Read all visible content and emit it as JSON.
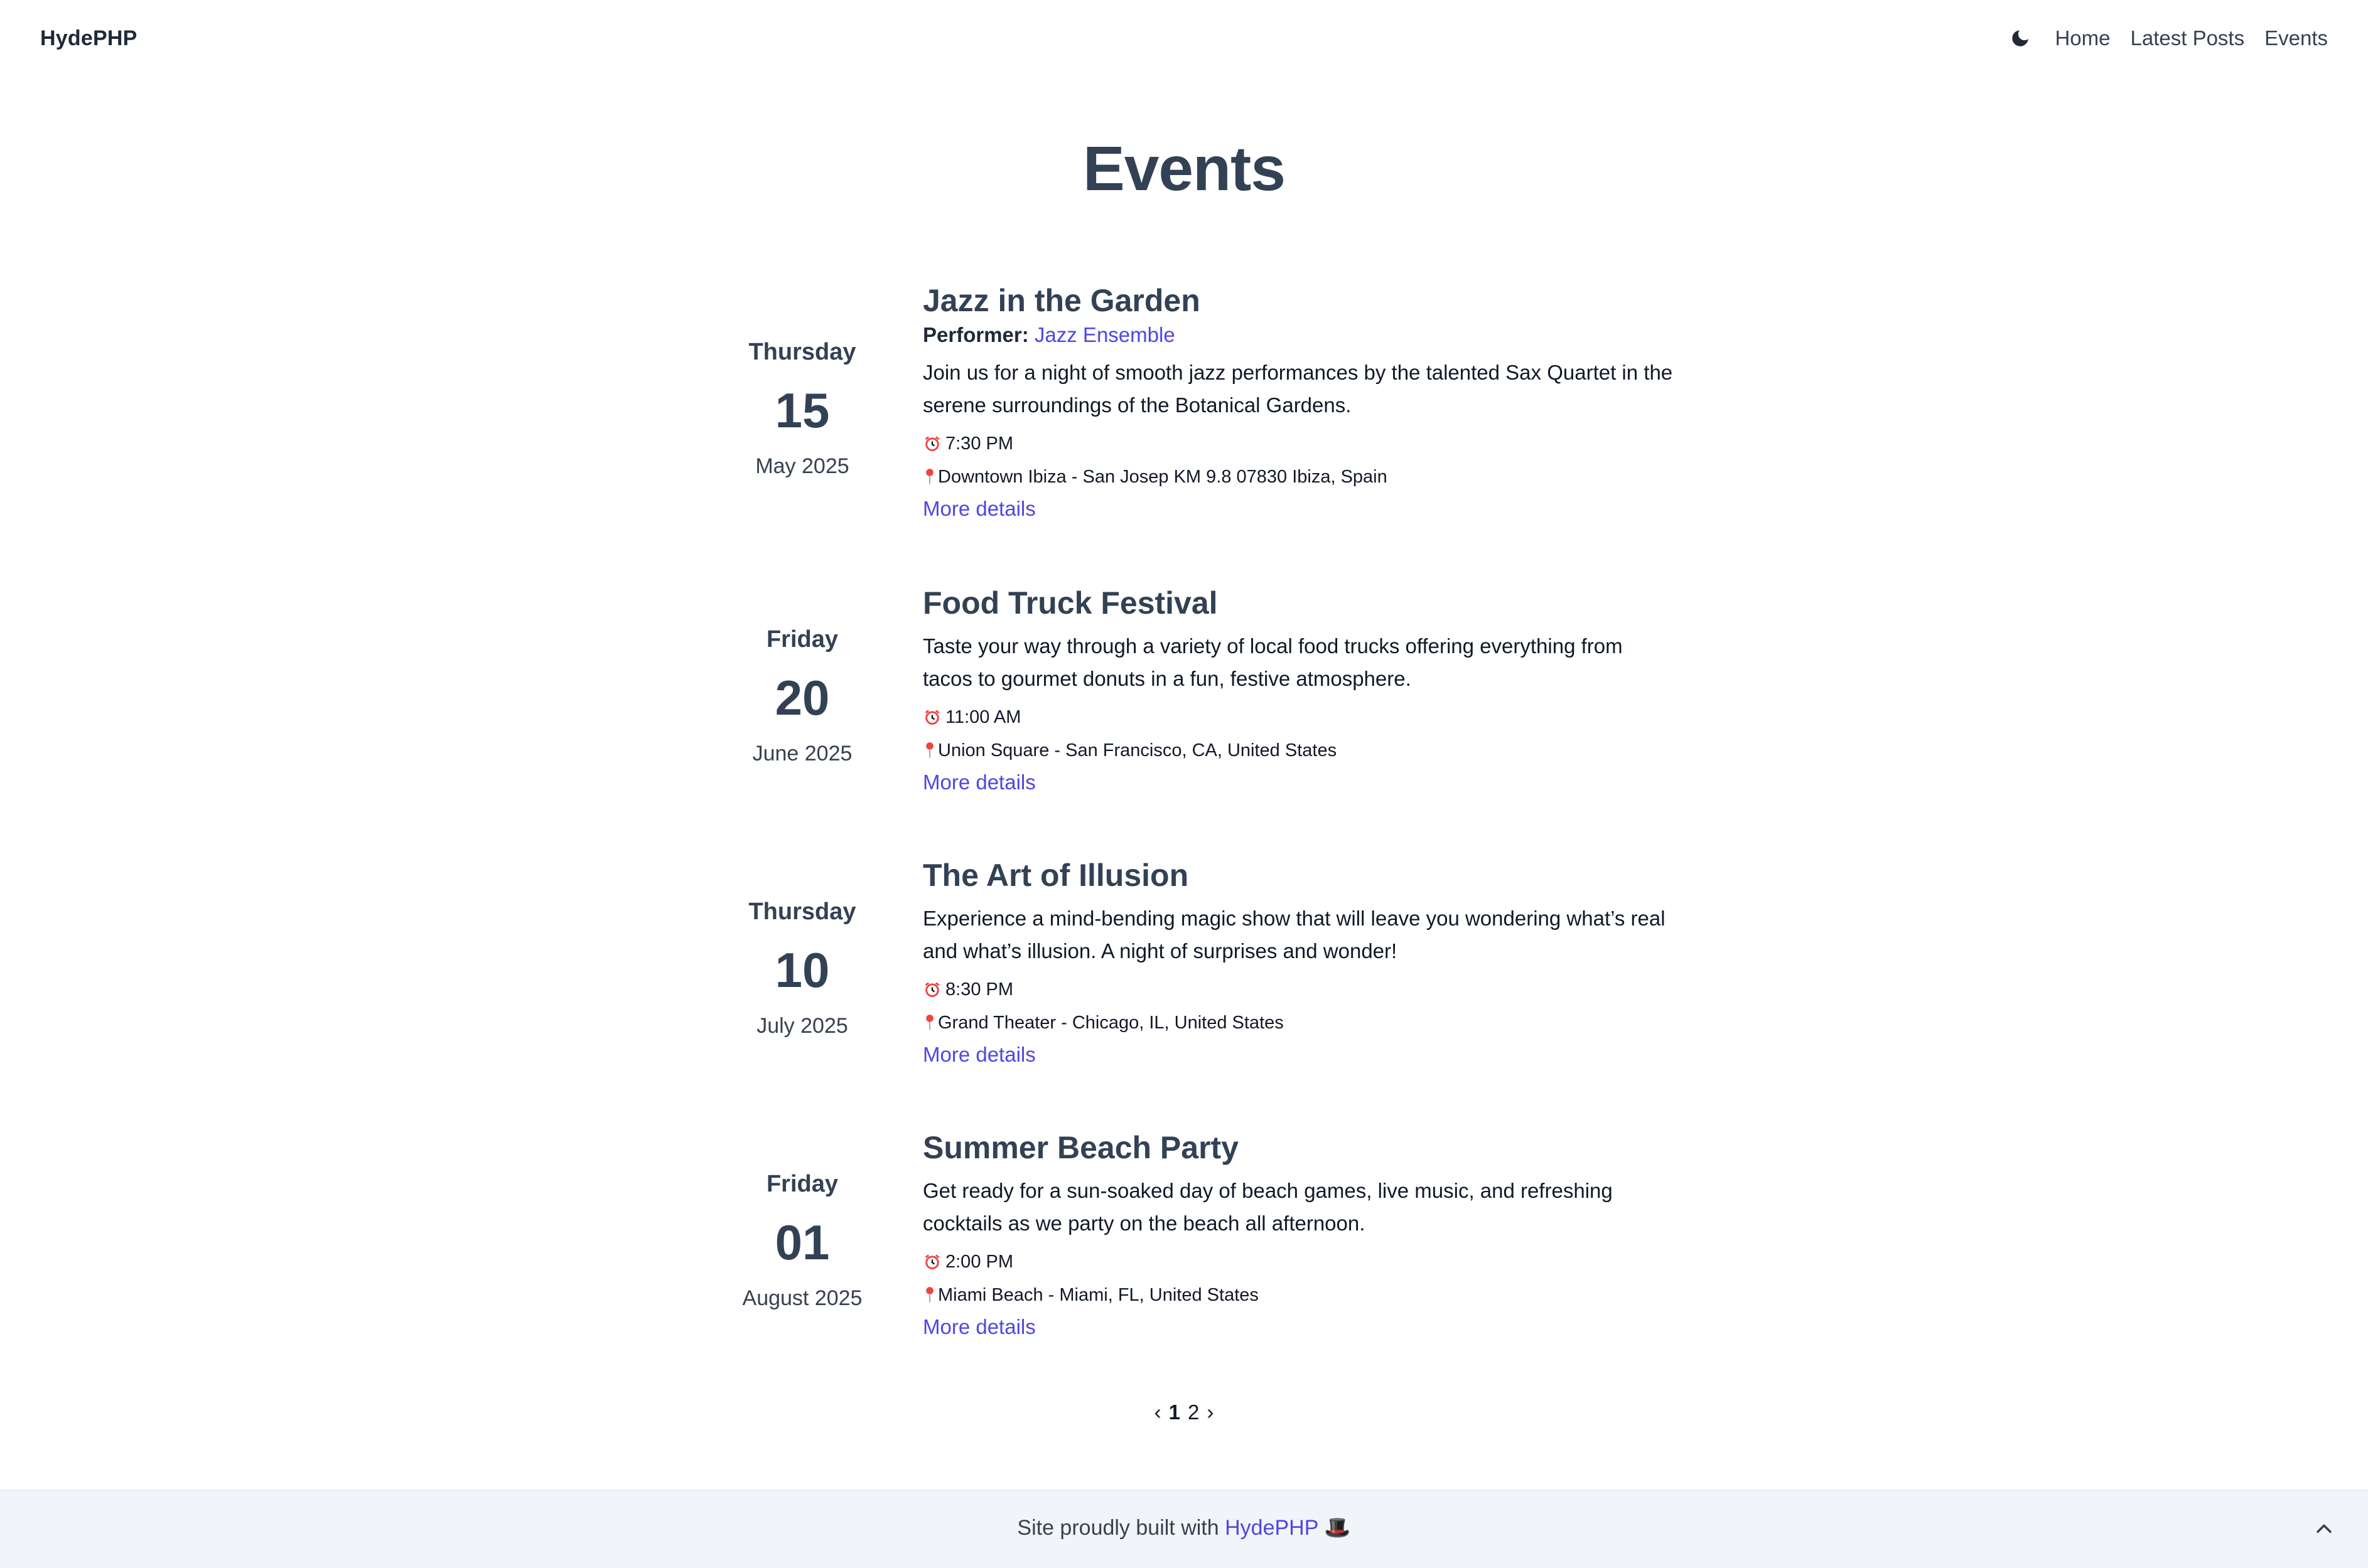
{
  "header": {
    "brand": "HydePHP",
    "nav": [
      "Home",
      "Latest Posts",
      "Events"
    ]
  },
  "page": {
    "title": "Events"
  },
  "events": [
    {
      "weekday": "Thursday",
      "day": "15",
      "month_year": "May 2025",
      "title": "Jazz in the Garden",
      "performer_label": "Performer:",
      "performer": "Jazz Ensemble",
      "description": "Join us for a night of smooth jazz performances by the talented Sax Quartet in the serene surroundings of the Botanical Gardens.",
      "time": "7:30 PM",
      "location": "Downtown Ibiza - San Josep KM 9.8 07830 Ibiza, Spain",
      "more": "More details"
    },
    {
      "weekday": "Friday",
      "day": "20",
      "month_year": "June 2025",
      "title": "Food Truck Festival",
      "description": "Taste your way through a variety of local food trucks offering everything from tacos to gourmet donuts in a fun, festive atmosphere.",
      "time": "11:00 AM",
      "location": "Union Square - San Francisco, CA, United States",
      "more": "More details"
    },
    {
      "weekday": "Thursday",
      "day": "10",
      "month_year": "July 2025",
      "title": "The Art of Illusion",
      "description": "Experience a mind-bending magic show that will leave you wondering what’s real and what’s illusion. A night of surprises and wonder!",
      "time": "8:30 PM",
      "location": "Grand Theater - Chicago, IL, United States",
      "more": "More details"
    },
    {
      "weekday": "Friday",
      "day": "01",
      "month_year": "August 2025",
      "title": "Summer Beach Party",
      "description": "Get ready for a sun-soaked day of beach games, live music, and refreshing cocktails as we party on the beach all afternoon.",
      "time": "2:00 PM",
      "location": "Miami Beach - Miami, FL, United States",
      "more": "More details"
    }
  ],
  "pagination": {
    "prev": "‹",
    "pages": [
      "1",
      "2"
    ],
    "current": "1",
    "next": "›"
  },
  "footer": {
    "text": "Site proudly built with",
    "link": "HydePHP",
    "emoji": "🎩"
  },
  "icons": {
    "theme": "moon-icon",
    "time": "alarm-clock-icon",
    "location": "pin-icon",
    "to_top": "chevron-up-icon"
  },
  "colors": {
    "accent": "#4f46e5",
    "heading": "#334155",
    "footer_bg": "#f1f5f9",
    "pin": "#ef4444"
  }
}
